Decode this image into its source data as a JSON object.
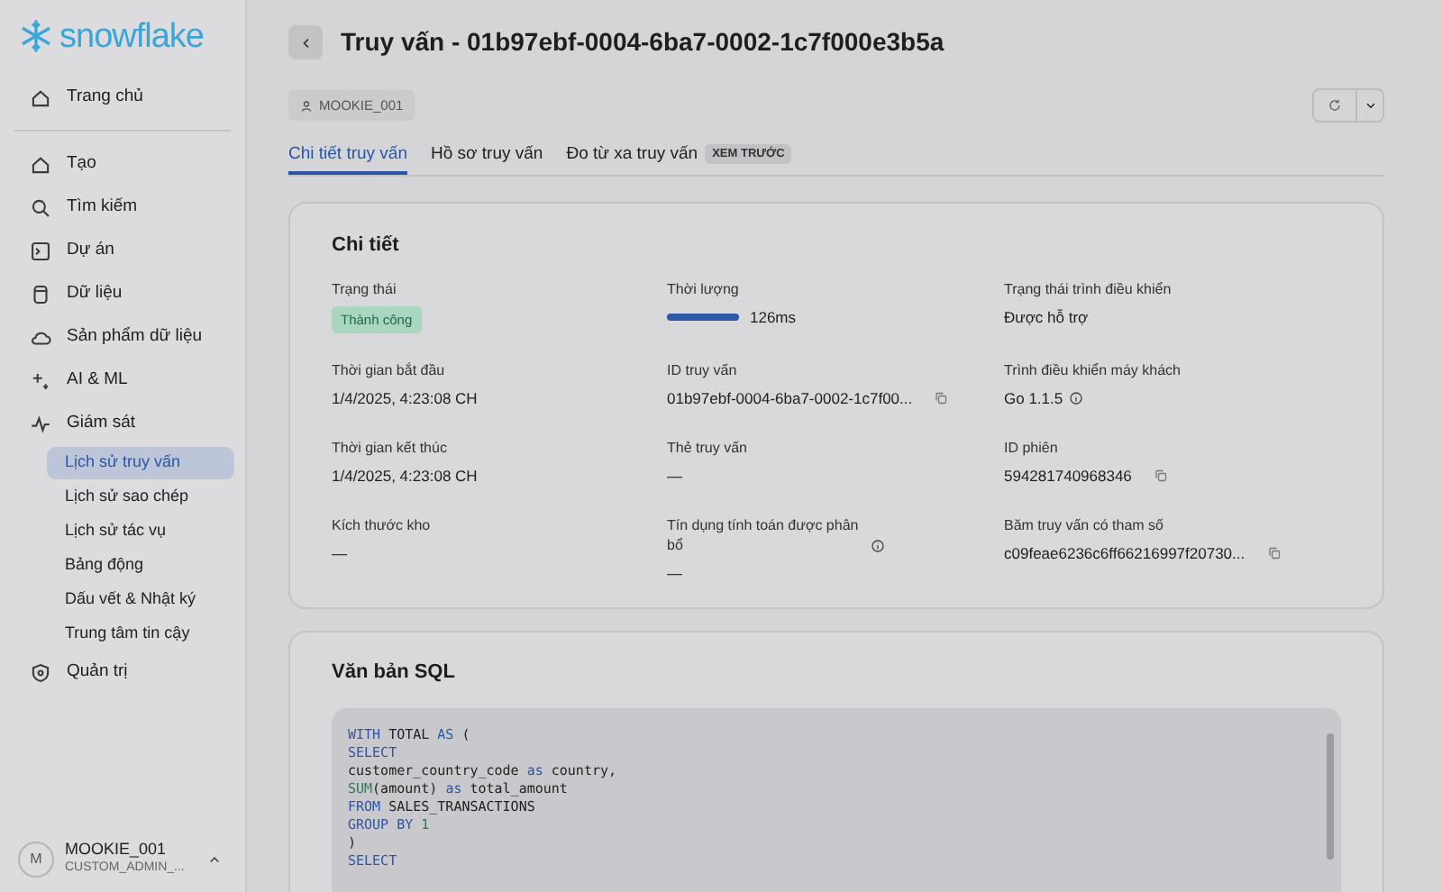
{
  "sidebar": {
    "logo": "snowflake",
    "items": [
      {
        "label": "Trang chủ",
        "selected": false
      },
      {
        "label": "Tạo",
        "selected": false
      },
      {
        "label": "Tìm kiếm",
        "selected": false
      },
      {
        "label": "Dự án",
        "selected": false
      },
      {
        "label": "Dữ liệu",
        "selected": false
      },
      {
        "label": "Sản phẩm dữ liệu",
        "selected": false
      },
      {
        "label": "AI & ML",
        "selected": false
      },
      {
        "label": "Giám sát",
        "selected": false,
        "children": [
          {
            "label": "Lịch sử truy vấn",
            "selected": true
          },
          {
            "label": "Lịch sử sao chép",
            "selected": false
          },
          {
            "label": "Lịch sử tác vụ",
            "selected": false
          },
          {
            "label": "Bảng động",
            "selected": false
          },
          {
            "label": "Dấu vết & Nhật ký",
            "selected": false
          },
          {
            "label": "Trung tâm tin cậy",
            "selected": false
          }
        ]
      },
      {
        "label": "Quản trị",
        "selected": false
      }
    ],
    "user": {
      "initial": "M",
      "name": "MOOKIE_001",
      "role": "CUSTOM_ADMIN_..."
    }
  },
  "header": {
    "title": "Truy vấn - 01b97ebf-0004-6ba7-0002-1c7f000e3b5a",
    "user_chip": "MOOKIE_001"
  },
  "tabs": [
    {
      "label": "Chi tiết truy vấn",
      "selected": true
    },
    {
      "label": "Hồ sơ truy vấn",
      "selected": false
    },
    {
      "label": "Đo từ xa truy vấn",
      "selected": false,
      "badge": "XEM TRƯỚC"
    }
  ],
  "details": {
    "title": "Chi tiết",
    "fields": [
      {
        "label": "Trạng thái",
        "kind": "badge",
        "value": "Thành công"
      },
      {
        "label": "Thời lượng",
        "kind": "bar",
        "value": "126ms",
        "level": 1
      },
      {
        "label": "Trạng thái trình điều khiển",
        "kind": "text",
        "value": "Được hỗ trợ"
      },
      {
        "label": "Thời gian bắt đầu",
        "kind": "text",
        "value": "1/4/2025, 4:23:08 CH"
      },
      {
        "label": "ID truy vấn",
        "kind": "text",
        "value": "01b97ebf-0004-6ba7-0002-1c7f00...",
        "copy": true
      },
      {
        "label": "Trình điều khiển máy khách",
        "kind": "text",
        "value": "Go 1.1.5",
        "info": true
      },
      {
        "label": "Thời gian kết thúc",
        "kind": "text",
        "value": "1/4/2025, 4:23:08 CH"
      },
      {
        "label": "Thẻ truy vấn",
        "kind": "text",
        "value": "—"
      },
      {
        "label": "ID phiên",
        "kind": "text",
        "value": "594281740968346",
        "copy": true
      },
      {
        "label": "Kích thước kho",
        "kind": "text",
        "value": "—"
      },
      {
        "label": "Tín dụng tính toán được phân bổ",
        "kind": "text",
        "value": "—",
        "label_info": true
      },
      {
        "label": "Băm truy vấn có tham số",
        "kind": "text",
        "value": "c09feae6236c6ff66216997f20730...",
        "copy": true
      }
    ]
  },
  "sql": {
    "title": "Văn bản SQL",
    "lines": [
      [
        {
          "text": "WITH",
          "kind": "keyword"
        },
        {
          "text": " TOTAL ",
          "kind": "plain"
        },
        {
          "text": "AS",
          "kind": "keyword"
        },
        {
          "text": " (",
          "kind": "plain"
        }
      ],
      [
        {
          "text": "SELECT",
          "kind": "keyword"
        }
      ],
      [
        {
          "text": "customer_country_code ",
          "kind": "plain"
        },
        {
          "text": "as",
          "kind": "keyword"
        },
        {
          "text": " country,",
          "kind": "plain"
        }
      ],
      [
        {
          "text": "SUM",
          "kind": "function"
        },
        {
          "text": "(amount) ",
          "kind": "plain"
        },
        {
          "text": "as",
          "kind": "keyword"
        },
        {
          "text": " total_amount",
          "kind": "plain"
        }
      ],
      [
        {
          "text": "FROM",
          "kind": "keyword"
        },
        {
          "text": " SALES_TRANSACTIONS",
          "kind": "plain"
        }
      ],
      [
        {
          "text": "GROUP BY ",
          "kind": "keyword"
        },
        {
          "text": "1",
          "kind": "number"
        }
      ],
      [
        {
          "text": ")",
          "kind": "plain"
        }
      ],
      [
        {
          "text": "SELECT",
          "kind": "keyword"
        }
      ]
    ]
  }
}
